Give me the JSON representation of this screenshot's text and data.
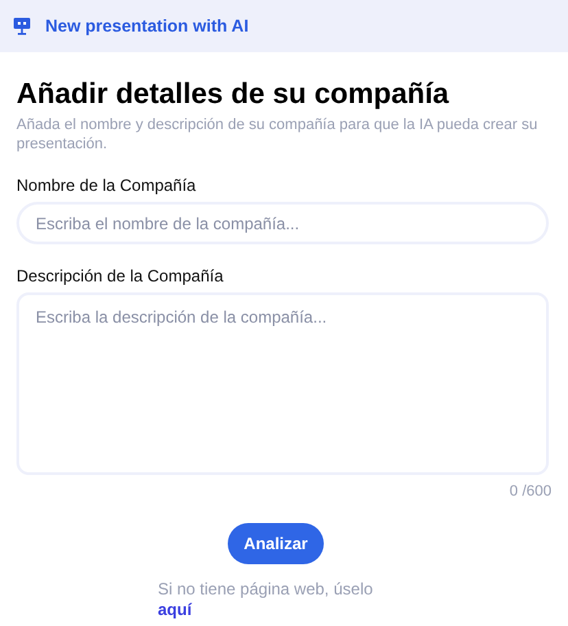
{
  "header": {
    "title": "New presentation with AI"
  },
  "heading": "Añadir detalles de su compañía",
  "subtitle": "Añada el nombre y descripción de su compañía para que la IA  pueda crear su presentación.",
  "fields": [
    {
      "kind": "input",
      "label": "Nombre de la Compañía",
      "placeholder": "Escriba el nombre de la compañía..."
    },
    {
      "kind": "textarea",
      "label": "Descripción de la Compañía",
      "placeholder": "Escriba la descripción de la compañía...",
      "counter": "0 /600"
    }
  ],
  "button": "Analizar",
  "footer": {
    "text": "Si no tiene página web, úselo",
    "link": "aquí"
  }
}
